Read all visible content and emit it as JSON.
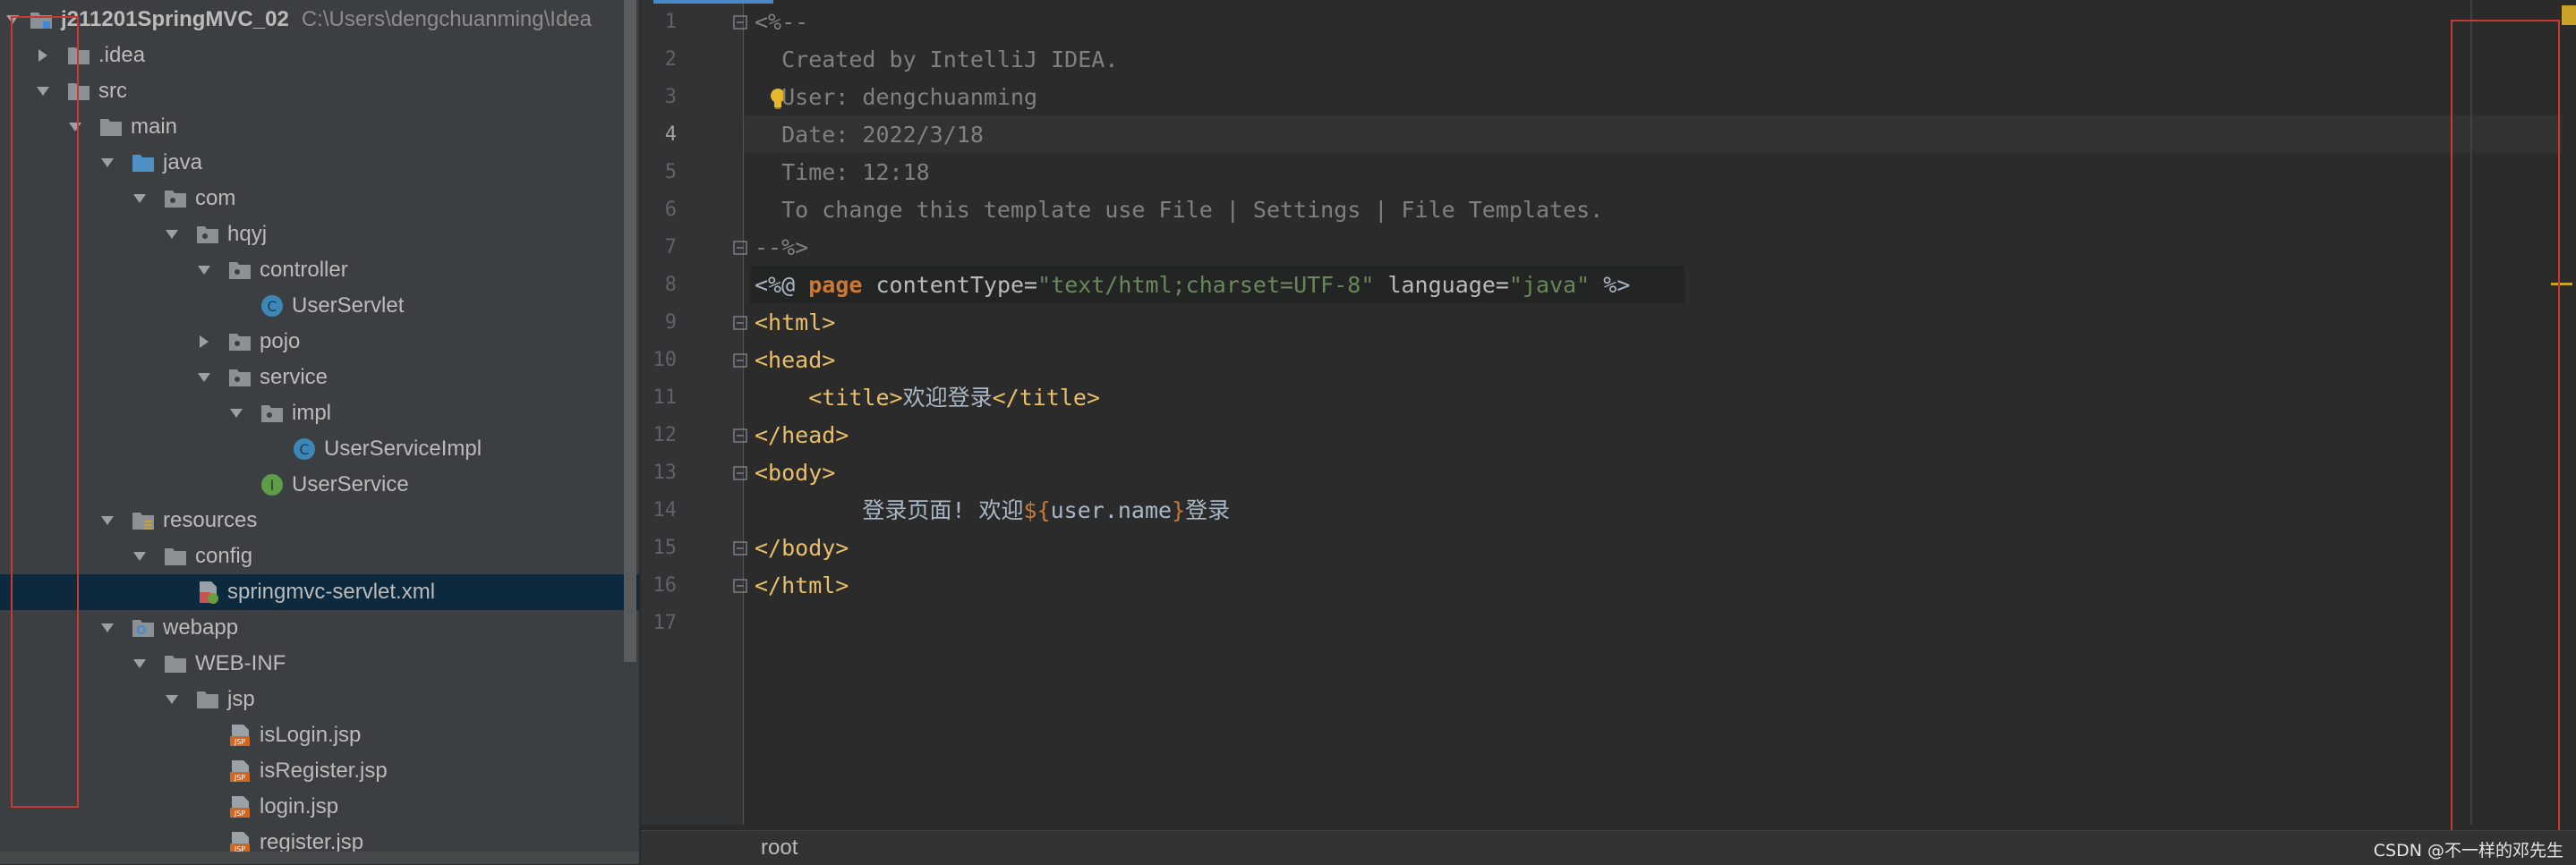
{
  "project": {
    "name": "j211201SpringMVC_02",
    "path": "C:\\Users\\dengchuanming\\Idea",
    "items": [
      {
        "label": ".idea",
        "icon": "folder-icon"
      },
      {
        "label": "src",
        "icon": "folder-icon"
      },
      {
        "label": "main",
        "icon": "folder-icon"
      },
      {
        "label": "java",
        "icon": "source-folder-icon"
      },
      {
        "label": "com",
        "icon": "package-icon"
      },
      {
        "label": "hqyj",
        "icon": "package-icon"
      },
      {
        "label": "controller",
        "icon": "package-icon"
      },
      {
        "label": "UserServlet",
        "icon": "class-icon"
      },
      {
        "label": "pojo",
        "icon": "package-icon"
      },
      {
        "label": "service",
        "icon": "package-icon"
      },
      {
        "label": "impl",
        "icon": "package-icon"
      },
      {
        "label": "UserServiceImpl",
        "icon": "class-icon"
      },
      {
        "label": "UserService",
        "icon": "interface-icon"
      },
      {
        "label": "resources",
        "icon": "resources-folder-icon"
      },
      {
        "label": "config",
        "icon": "folder-icon"
      },
      {
        "label": "springmvc-servlet.xml",
        "icon": "xml-file-icon"
      },
      {
        "label": "webapp",
        "icon": "web-folder-icon"
      },
      {
        "label": "WEB-INF",
        "icon": "folder-icon"
      },
      {
        "label": "jsp",
        "icon": "folder-icon"
      },
      {
        "label": "isLogin.jsp",
        "icon": "jsp-file-icon"
      },
      {
        "label": "isRegister.jsp",
        "icon": "jsp-file-icon"
      },
      {
        "label": "login.jsp",
        "icon": "jsp-file-icon"
      },
      {
        "label": "register.jsp",
        "icon": "jsp-file-icon"
      }
    ]
  },
  "editor": {
    "line_numbers": [
      "1",
      "2",
      "3",
      "4",
      "5",
      "6",
      "7",
      "8",
      "9",
      "10",
      "11",
      "12",
      "13",
      "14",
      "15",
      "16",
      "17"
    ],
    "current_line": "4",
    "code": {
      "l1": "<%--",
      "l2": "  Created by IntelliJ IDEA.",
      "l3": "  User: dengchuanming",
      "l4": "  Date: 2022/3/18",
      "l5": "  Time: 12:18",
      "l6": "  To change this template use File | Settings | File Templates.",
      "l7": "--%>",
      "l8_open": "<%@ ",
      "l8_page": "page",
      "l8_attr1": " contentType=",
      "l8_val1": "\"text/html;charset=UTF-8\"",
      "l8_attr2": " language=",
      "l8_val2": "\"java\"",
      "l8_close": " %>",
      "l9": "<html>",
      "l10": "<head>",
      "l11_open": "    <title>",
      "l11_text": "欢迎登录",
      "l11_close": "</title>",
      "l12": "</head>",
      "l13": "<body>",
      "l14_text1": "        登录页面! 欢迎",
      "l14_el_open": "${",
      "l14_var": "user.name",
      "l14_el_close": "}",
      "l14_text2": "登录",
      "l15": "</body>",
      "l16": "</html>"
    }
  },
  "breadcrumb": "root",
  "watermark": "CSDN @不一样的邓先生",
  "colors": {
    "highlight_box": "#c73a32",
    "tag": "#e8bf6a",
    "comment": "#808080",
    "string": "#6a8759",
    "keyword": "#cc7832"
  }
}
